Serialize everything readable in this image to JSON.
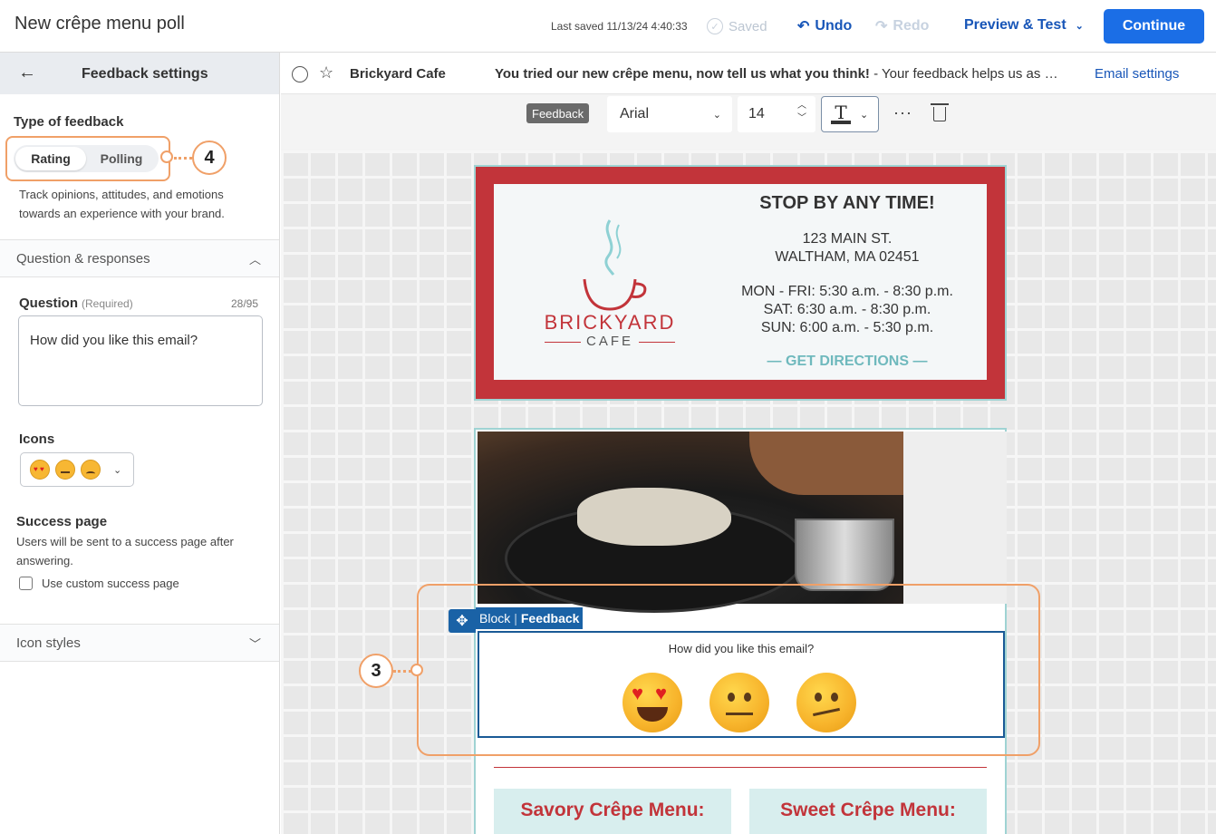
{
  "header": {
    "title": "New crêpe menu poll",
    "last_saved": "Last saved 11/13/24 4:40:33",
    "saved": "Saved",
    "undo": "Undo",
    "redo": "Redo",
    "preview": "Preview & Test",
    "continue": "Continue"
  },
  "sidebar": {
    "title": "Feedback settings",
    "type_label": "Type of feedback",
    "type_options": [
      "Rating",
      "Polling"
    ],
    "type_selected": "Rating",
    "type_desc": "Track opinions, attitudes, and emotions towards an experience with your brand.",
    "section_qr": "Question & responses",
    "question_label": "Question",
    "question_required": "(Required)",
    "question_count": "28/95",
    "question_value": "How did you like this email?",
    "icons_label": "Icons",
    "success_label": "Success page",
    "success_desc": "Users will be sent to a success page after answering.",
    "custom_success": "Use custom success page",
    "section_icon_styles": "Icon styles"
  },
  "email_header": {
    "from": "Brickyard Cafe",
    "subject": "You tried our new crêpe menu, now tell us what you think!",
    "preheader": " - Your feedback helps us as …",
    "settings_link": "Email settings"
  },
  "toolbar": {
    "badge": "Feedback",
    "font": "Arial",
    "size": "14"
  },
  "email": {
    "brand": "BRICKYARD",
    "brand_sub": "CAFE",
    "store_heading": "STOP BY ANY TIME!",
    "address1": "123 MAIN ST.",
    "address2": "WALTHAM, MA 02451",
    "hours1": "MON - FRI: 5:30 a.m. - 8:30 p.m.",
    "hours2": "SAT: 6:30 a.m. - 8:30 p.m.",
    "hours3": "SUN: 6:00 a.m. - 5:30 p.m.",
    "directions": "— GET DIRECTIONS —",
    "block_tag": "Block",
    "block_type": "Feedback",
    "feedback_question": "How did you like this email?",
    "menu_left": "Savory Crêpe Menu:",
    "menu_right": "Sweet Crêpe Menu:"
  },
  "callouts": {
    "three": "3",
    "four": "4"
  },
  "colors": {
    "accent": "#1b6ee6",
    "link": "#1856b8",
    "brand_red": "#c2343a",
    "teal": "#6fb9bd",
    "callout": "#f0a068"
  }
}
